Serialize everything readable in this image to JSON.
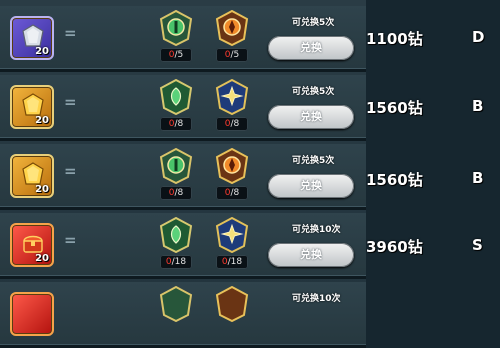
{
  "rows": [
    {
      "quantity": "20",
      "mat1_count_current": "0",
      "mat1_count_total": "/5",
      "mat2_count_current": "0",
      "mat2_count_total": "/5",
      "limit": "可兑换5次",
      "button": "兑换",
      "price": "1100钻",
      "grade": "D",
      "item_icon": "gray-crystal-icon",
      "mat1_icon": "green-shield-emblem-icon",
      "mat2_icon": "orange-shield-emblem-icon"
    },
    {
      "quantity": "20",
      "mat1_count_current": "0",
      "mat1_count_total": "/8",
      "mat2_count_current": "0",
      "mat2_count_total": "/8",
      "limit": "可兑换5次",
      "button": "兑换",
      "price": "1560钻",
      "grade": "B",
      "item_icon": "gold-crystal-icon",
      "mat1_icon": "green-leaf-emblem-icon",
      "mat2_icon": "blue-star-emblem-icon"
    },
    {
      "quantity": "20",
      "mat1_count_current": "0",
      "mat1_count_total": "/8",
      "mat2_count_current": "0",
      "mat2_count_total": "/8",
      "limit": "可兑换5次",
      "button": "兑换",
      "price": "1560钻",
      "grade": "B",
      "item_icon": "gold-crystal-icon",
      "mat1_icon": "green-shield-emblem-icon",
      "mat2_icon": "orange-shield-emblem-icon"
    },
    {
      "quantity": "20",
      "mat1_count_current": "0",
      "mat1_count_total": "/18",
      "mat2_count_current": "0",
      "mat2_count_total": "/18",
      "limit": "可兑换10次",
      "button": "兑换",
      "price": "3960钻",
      "grade": "S",
      "item_icon": "red-treasure-chest-icon",
      "mat1_icon": "green-leaf-emblem-icon",
      "mat2_icon": "blue-star-emblem-icon"
    },
    {
      "limit": "可兑换10次",
      "item_icon": "red-treasure-chest-icon",
      "mat1_icon": "green-shield-emblem-icon",
      "mat2_icon": "orange-shield-emblem-icon"
    }
  ],
  "colors": {
    "count_zero": "#ff3b2f",
    "button_bg": "#e8e8e8"
  }
}
